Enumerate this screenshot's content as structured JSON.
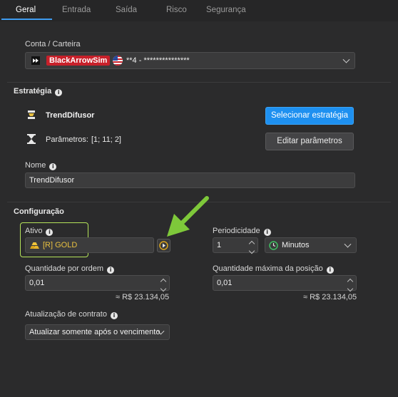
{
  "tabs": [
    {
      "label": "Geral"
    },
    {
      "label": "Entrada"
    },
    {
      "label": "Saída"
    },
    {
      "label": "Risco"
    },
    {
      "label": "Segurança"
    }
  ],
  "account": {
    "label": "Conta / Carteira",
    "broker": "BlackArrowSim",
    "account_id": "**4 - ***************"
  },
  "strategy": {
    "section_title": "Estratégia",
    "name": "TrendDifusor",
    "params_label": "Parâmetros:",
    "params_value": "[1; 11; 2]",
    "select_button": "Selecionar estratégia",
    "edit_button": "Editar parâmetros"
  },
  "name_field": {
    "label": "Nome",
    "value": "TrendDifusor"
  },
  "config": {
    "section_title": "Configuração",
    "asset_label": "Ativo",
    "asset_value": "[R] GOLD",
    "period_label": "Periodicidade",
    "period_value": "1",
    "period_unit": "Minutos",
    "qty_label": "Quantidade por ordem",
    "qty_value": "0,01",
    "qty_approx": "≈ R$ 23.134,05",
    "max_qty_label": "Quantidade máxima da posição",
    "max_qty_value": "0,01",
    "max_qty_approx": "≈ R$ 23.134,05",
    "contract_label": "Atualização de contrato",
    "contract_value": "Atualizar somente após o vencimento"
  },
  "colors": {
    "accent": "#1e90f0",
    "highlight_border": "#b5e35a",
    "arrow": "#7ec83a",
    "broker_badge": "#c8202a"
  }
}
